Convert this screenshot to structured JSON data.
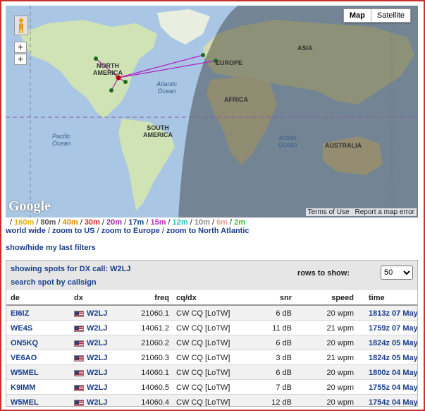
{
  "map": {
    "type_buttons": [
      "Map",
      "Satellite"
    ],
    "zoom_in": "+",
    "zoom_out": "+",
    "logo": "Google",
    "terms": "Terms of Use",
    "report": "Report a map error",
    "labels": {
      "north_america": "NORTH\nAMERICA",
      "south_america": "SOUTH\nAMERICA",
      "europe": "EUROPE",
      "asia": "ASIA",
      "africa": "AFRICA",
      "australia": "AUSTRALIA",
      "atlantic": "Atlantic\nOcean",
      "pacific": "Pacific\nOcean",
      "indian": "Indian\nOcean"
    }
  },
  "bands": [
    {
      "label": "160m",
      "color": "#e0b000"
    },
    {
      "label": "80m",
      "color": "#555555"
    },
    {
      "label": "40m",
      "color": "#e08a00"
    },
    {
      "label": "30m",
      "color": "#d62b2b"
    },
    {
      "label": "20m",
      "color": "#9b2b9b"
    },
    {
      "label": "17m",
      "color": "#1a3f8a"
    },
    {
      "label": "15m",
      "color": "#c02bc0"
    },
    {
      "label": "12m",
      "color": "#22c0c0"
    },
    {
      "label": "10m",
      "color": "#888888"
    },
    {
      "label": "6m",
      "color": "#e8a0a0"
    },
    {
      "label": "2m",
      "color": "#33c033"
    }
  ],
  "zoom_links": [
    "world wide",
    "zoom to US",
    "zoom to Europe",
    "zoom to North Atlantic"
  ],
  "filters_link": "show/hide my last filters",
  "panel": {
    "showing": "showing spots for DX call: W2LJ",
    "search": "search spot by callsign",
    "rows_label": "rows to show:",
    "rows_value": "50",
    "columns": {
      "de": "de",
      "dx": "dx",
      "freq": "freq",
      "cq": "cq/dx",
      "snr": "snr",
      "speed": "speed",
      "time": "time"
    }
  },
  "spots": [
    {
      "de": "EI6IZ",
      "dx": "W2LJ",
      "freq": "21060.1",
      "cq": "CW CQ [LoTW]",
      "snr": "6 dB",
      "speed": "20 wpm",
      "time": "1813z 07 May"
    },
    {
      "de": "WE4S",
      "dx": "W2LJ",
      "freq": "14061.2",
      "cq": "CW CQ [LoTW]",
      "snr": "11 dB",
      "speed": "21 wpm",
      "time": "1759z 07 May"
    },
    {
      "de": "ON5KQ",
      "dx": "W2LJ",
      "freq": "21060.2",
      "cq": "CW CQ [LoTW]",
      "snr": "6 dB",
      "speed": "20 wpm",
      "time": "1824z 05 May"
    },
    {
      "de": "VE6AO",
      "dx": "W2LJ",
      "freq": "21060.3",
      "cq": "CW CQ [LoTW]",
      "snr": "3 dB",
      "speed": "21 wpm",
      "time": "1824z 05 May"
    },
    {
      "de": "W5MEL",
      "dx": "W2LJ",
      "freq": "14060.1",
      "cq": "CW CQ [LoTW]",
      "snr": "6 dB",
      "speed": "20 wpm",
      "time": "1800z 04 May"
    },
    {
      "de": "K9IMM",
      "dx": "W2LJ",
      "freq": "14060.5",
      "cq": "CW CQ [LoTW]",
      "snr": "7 dB",
      "speed": "20 wpm",
      "time": "1755z 04 May"
    },
    {
      "de": "W5MEL",
      "dx": "W2LJ",
      "freq": "14060.4",
      "cq": "CW CQ [LoTW]",
      "snr": "12 dB",
      "speed": "20 wpm",
      "time": "1754z 04 May"
    }
  ]
}
